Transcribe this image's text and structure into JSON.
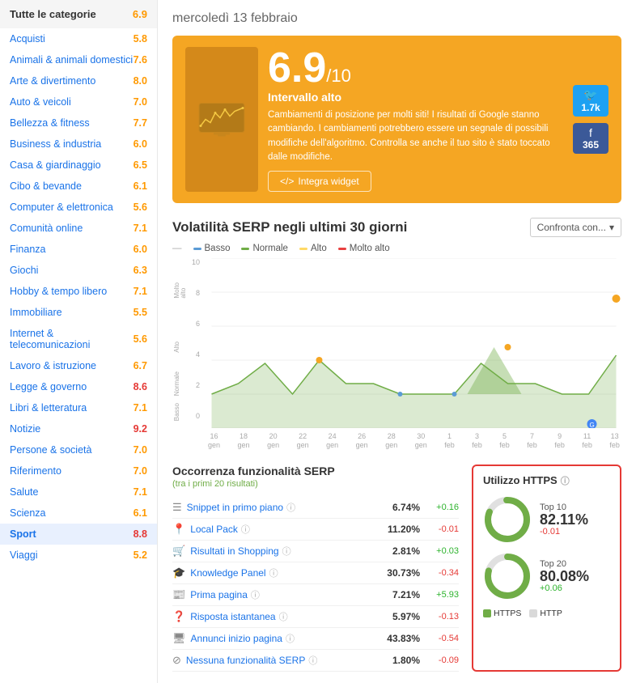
{
  "sidebar": {
    "title": "Tutte le categorie",
    "title_score": "6.9",
    "items": [
      {
        "label": "Acquisti",
        "score": "5.8",
        "scoreClass": "score-orange"
      },
      {
        "label": "Animali & animali domestici",
        "score": "7.6",
        "scoreClass": "score-orange"
      },
      {
        "label": "Arte & divertimento",
        "score": "8.0",
        "scoreClass": "score-orange"
      },
      {
        "label": "Auto & veicoli",
        "score": "7.0",
        "scoreClass": "score-orange"
      },
      {
        "label": "Bellezza & fitness",
        "score": "7.7",
        "scoreClass": "score-orange"
      },
      {
        "label": "Business & industria",
        "score": "6.0",
        "scoreClass": "score-orange"
      },
      {
        "label": "Casa & giardinaggio",
        "score": "6.5",
        "scoreClass": "score-orange"
      },
      {
        "label": "Cibo & bevande",
        "score": "6.1",
        "scoreClass": "score-orange"
      },
      {
        "label": "Computer & elettronica",
        "score": "5.6",
        "scoreClass": "score-orange"
      },
      {
        "label": "Comunità online",
        "score": "7.1",
        "scoreClass": "score-orange"
      },
      {
        "label": "Finanza",
        "score": "6.0",
        "scoreClass": "score-orange"
      },
      {
        "label": "Giochi",
        "score": "6.3",
        "scoreClass": "score-orange"
      },
      {
        "label": "Hobby & tempo libero",
        "score": "7.1",
        "scoreClass": "score-orange"
      },
      {
        "label": "Immobiliare",
        "score": "5.5",
        "scoreClass": "score-orange"
      },
      {
        "label": "Internet & telecomunicazioni",
        "score": "5.6",
        "scoreClass": "score-orange"
      },
      {
        "label": "Lavoro & istruzione",
        "score": "6.7",
        "scoreClass": "score-orange"
      },
      {
        "label": "Legge & governo",
        "score": "8.6",
        "scoreClass": "score-red"
      },
      {
        "label": "Libri & letteratura",
        "score": "7.1",
        "scoreClass": "score-orange"
      },
      {
        "label": "Notizie",
        "score": "9.2",
        "scoreClass": "score-red"
      },
      {
        "label": "Persone & società",
        "score": "7.0",
        "scoreClass": "score-orange"
      },
      {
        "label": "Riferimento",
        "score": "7.0",
        "scoreClass": "score-orange"
      },
      {
        "label": "Salute",
        "score": "7.1",
        "scoreClass": "score-orange"
      },
      {
        "label": "Scienza",
        "score": "6.1",
        "scoreClass": "score-orange"
      },
      {
        "label": "Sport",
        "score": "8.8",
        "scoreClass": "score-red"
      },
      {
        "label": "Viaggi",
        "score": "5.2",
        "scoreClass": "score-orange"
      }
    ]
  },
  "main": {
    "date": "mercoledì 13 febbraio",
    "score_card": {
      "score": "6.9",
      "out_of": "/10",
      "level": "Intervallo alto",
      "description": "Cambiamenti di posizione per molti siti! I risultati di Google stanno cambiando. I cambiamenti potrebbero essere un segnale di possibili modifiche dell'algoritmo. Controlla se anche il tuo sito è stato toccato dalle modifiche.",
      "twitter_count": "1.7k",
      "facebook_count": "365",
      "integrate_label": "Integra widget"
    },
    "chart": {
      "title": "Volatilità SERP negli ultimi 30 giorni",
      "compare_label": "Confronta con...",
      "legend": [
        {
          "label": "Basso",
          "class": "basso"
        },
        {
          "label": "Normale",
          "class": "normale"
        },
        {
          "label": "Alto",
          "class": "alto"
        },
        {
          "label": "Molto alto",
          "class": "molto-alto"
        }
      ],
      "y_labels": [
        "10",
        "8",
        "6",
        "4",
        "2",
        "0"
      ],
      "y_axis_labels": [
        "Molto alto",
        "Alto",
        "Normale",
        "Basso"
      ],
      "x_labels": [
        {
          "line1": "16",
          "line2": "gen"
        },
        {
          "line1": "18",
          "line2": "gen"
        },
        {
          "line1": "20",
          "line2": "gen"
        },
        {
          "line1": "22",
          "line2": "gen"
        },
        {
          "line1": "24",
          "line2": "gen"
        },
        {
          "line1": "26",
          "line2": "gen"
        },
        {
          "line1": "28",
          "line2": "gen"
        },
        {
          "line1": "30",
          "line2": "gen"
        },
        {
          "line1": "1",
          "line2": "feb"
        },
        {
          "line1": "3",
          "line2": "feb"
        },
        {
          "line1": "5",
          "line2": "feb"
        },
        {
          "line1": "7",
          "line2": "feb"
        },
        {
          "line1": "9",
          "line2": "feb"
        },
        {
          "line1": "11",
          "line2": "feb"
        },
        {
          "line1": "13",
          "line2": "feb"
        }
      ]
    },
    "serp_features": {
      "title": "Occorrenza funzionalità SERP",
      "subtitle": "(tra i primi 20 risultati)",
      "rows": [
        {
          "icon": "☰",
          "name": "Snippet in primo piano",
          "pct": "6.74%",
          "delta": "+0.16",
          "delta_class": "delta-pos"
        },
        {
          "icon": "📍",
          "name": "Local Pack",
          "pct": "11.20%",
          "delta": "-0.01",
          "delta_class": "delta-neg"
        },
        {
          "icon": "🛒",
          "name": "Risultati in Shopping",
          "pct": "2.81%",
          "delta": "+0.03",
          "delta_class": "delta-pos"
        },
        {
          "icon": "🎓",
          "name": "Knowledge Panel",
          "pct": "30.73%",
          "delta": "-0.34",
          "delta_class": "delta-neg"
        },
        {
          "icon": "📰",
          "name": "Prima pagina",
          "pct": "7.21%",
          "delta": "+5.93",
          "delta_class": "delta-pos"
        },
        {
          "icon": "❓",
          "name": "Risposta istantanea",
          "pct": "5.97%",
          "delta": "-0.13",
          "delta_class": "delta-neg"
        },
        {
          "icon": "🖥",
          "name": "Annunci inizio pagina",
          "pct": "43.83%",
          "delta": "-0.54",
          "delta_class": "delta-neg"
        },
        {
          "icon": "⊘",
          "name": "Nessuna funzionalità SERP",
          "pct": "1.80%",
          "delta": "-0.09",
          "delta_class": "delta-neg"
        }
      ]
    },
    "https": {
      "title": "Utilizzo HTTPS",
      "top10_label": "Top 10",
      "top10_pct": "82.11%",
      "top10_delta": "-0.01",
      "top10_delta_class": "delta-neg",
      "top20_label": "Top 20",
      "top20_pct": "80.08%",
      "top20_delta": "+0.06",
      "top20_delta_class": "delta-pos",
      "legend_https": "HTTPS",
      "legend_http": "HTTP"
    }
  }
}
